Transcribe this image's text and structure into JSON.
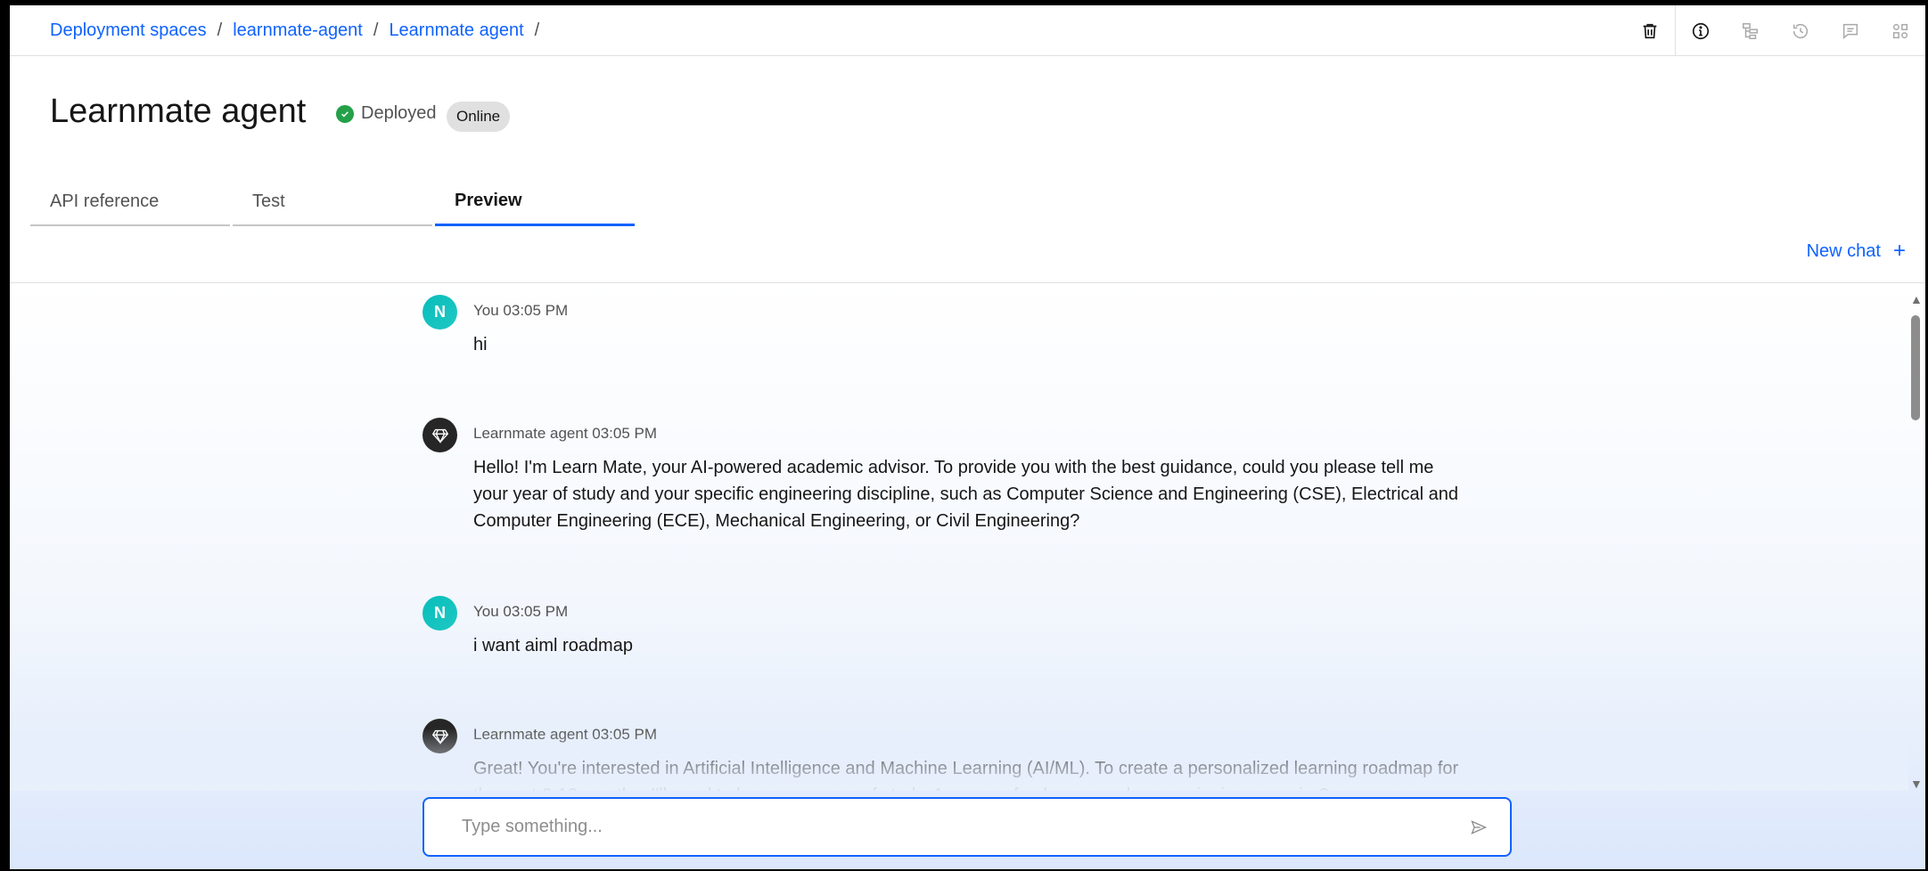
{
  "breadcrumb": {
    "items": [
      "Deployment spaces",
      "learnmate-agent",
      "Learnmate agent"
    ],
    "separator": "/"
  },
  "toolbar": {
    "icons": [
      "trash-icon",
      "info-icon",
      "tree-icon",
      "history-icon",
      "comment-icon",
      "apps-icon"
    ]
  },
  "header": {
    "title": "Learnmate agent",
    "status": "Deployed",
    "badge": "Online"
  },
  "tabs": [
    {
      "label": "API reference",
      "active": false
    },
    {
      "label": "Test",
      "active": false
    },
    {
      "label": "Preview",
      "active": true
    }
  ],
  "new_chat": {
    "label": "New chat",
    "icon": "+"
  },
  "messages": [
    {
      "role": "user",
      "avatar": "N",
      "meta": "You 03:05 PM",
      "text": "hi"
    },
    {
      "role": "agent",
      "avatar": "",
      "meta": "Learnmate agent 03:05 PM",
      "text": "Hello! I'm Learn Mate, your AI-powered academic advisor. To provide you with the best guidance, could you please tell me your year of study and your specific engineering discipline, such as Computer Science and Engineering (CSE), Electrical and Computer Engineering (ECE), Mechanical Engineering, or Civil Engineering?"
    },
    {
      "role": "user",
      "avatar": "N",
      "meta": "You 03:05 PM",
      "text": "i want aiml roadmap"
    },
    {
      "role": "agent",
      "avatar": "",
      "meta": "Learnmate agent 03:05 PM",
      "text": "Great! You're interested in Artificial Intelligence and Machine Learning (AI/ML). To create a personalized learning roadmap for the next 6-12 months, I'll need to know your year of study. Are you a freshman, sophomore, junior, or senior?"
    }
  ],
  "composer": {
    "placeholder": "Type something..."
  },
  "colors": {
    "accent": "#0f62fe",
    "success": "#24a148",
    "user_avatar": "#08bdba",
    "agent_avatar": "#262626"
  }
}
